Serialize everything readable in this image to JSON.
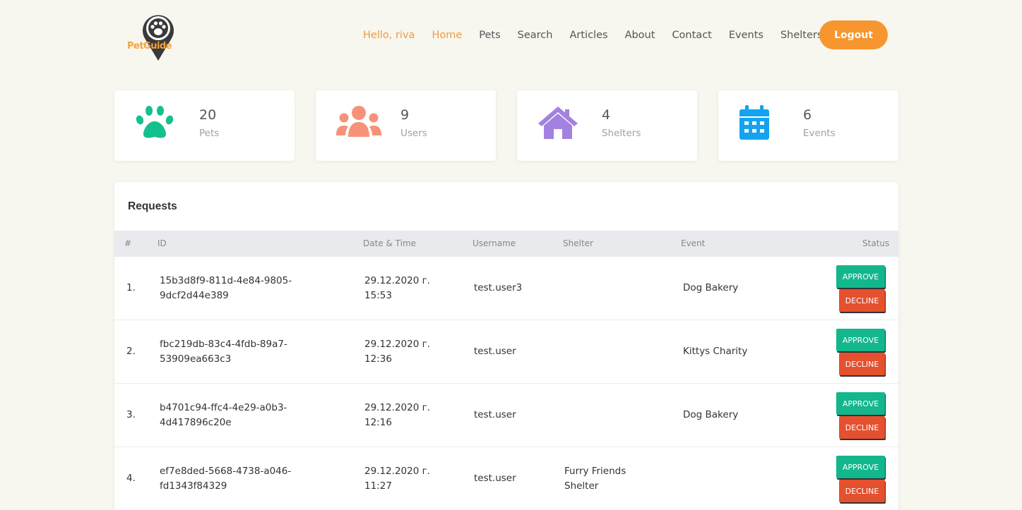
{
  "brand": {
    "logo_text": "PetGuide"
  },
  "colors": {
    "background": "#f7f6ef",
    "accent": "#f7962e",
    "pets": "#14c08e",
    "users": "#f7927a",
    "shelters": "#a381e0",
    "events": "#14a3f0",
    "approve": "#14b78b",
    "decline": "#e5502e"
  },
  "nav": {
    "greeting": "Hello, riva",
    "items": [
      "Home",
      "Pets",
      "Search",
      "Articles",
      "About",
      "Contact",
      "Events",
      "Shelters"
    ],
    "logout": "Logout"
  },
  "stats": [
    {
      "icon": "paw-icon",
      "value": "20",
      "label": "Pets"
    },
    {
      "icon": "users-icon",
      "value": "9",
      "label": "Users"
    },
    {
      "icon": "house-icon",
      "value": "4",
      "label": "Shelters"
    },
    {
      "icon": "calendar-icon",
      "value": "6",
      "label": "Events"
    }
  ],
  "requests": {
    "title": "Requests",
    "columns": [
      "#",
      "ID",
      "Date & Time",
      "Username",
      "Shelter",
      "Event",
      "Status"
    ],
    "rows": [
      {
        "num": "1.",
        "id_line1": "15b3d8f9-811d-4e84-9805-",
        "id_line2": "9dcf2d44e389",
        "date": "29.12.2020 г.",
        "time": "15:53",
        "username": "test.user3",
        "shelter_line1": "",
        "shelter_line2": "",
        "event": "Dog Bakery"
      },
      {
        "num": "2.",
        "id_line1": "fbc219db-83c4-4fdb-89a7-",
        "id_line2": "53909ea663c3",
        "date": "29.12.2020 г.",
        "time": "12:36",
        "username": "test.user",
        "shelter_line1": "",
        "shelter_line2": "",
        "event": "Kittys Charity"
      },
      {
        "num": "3.",
        "id_line1": "b4701c94-ffc4-4e29-a0b3-",
        "id_line2": "4d417896c20e",
        "date": "29.12.2020 г.",
        "time": "12:16",
        "username": "test.user",
        "shelter_line1": "",
        "shelter_line2": "",
        "event": "Dog Bakery"
      },
      {
        "num": "4.",
        "id_line1": "ef7e8ded-5668-4738-a046-",
        "id_line2": "fd1343f84329",
        "date": "29.12.2020 г.",
        "time": "11:27",
        "username": "test.user",
        "shelter_line1": "Furry Friends",
        "shelter_line2": "Shelter",
        "event": ""
      }
    ],
    "approve_label": "APPROVE",
    "decline_label": "DECLINE"
  }
}
